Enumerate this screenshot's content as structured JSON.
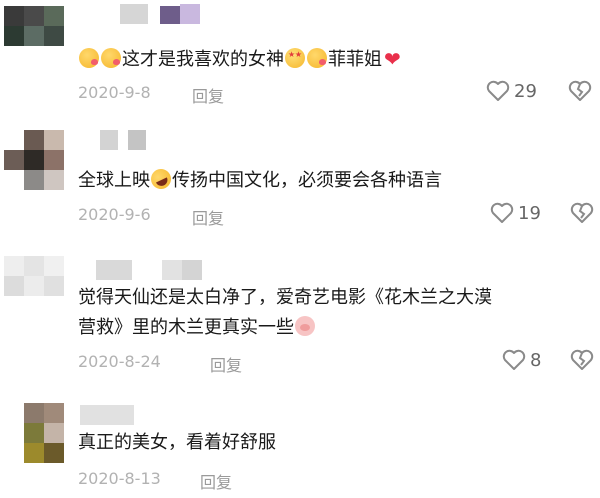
{
  "comments": [
    {
      "text_parts": [
        "这才是我喜欢的女神",
        "菲菲姐"
      ],
      "date": "2020-9-8",
      "reply_label": "回复",
      "likes": "29",
      "avatar_colors": [
        "#3a3a3a",
        "#4a4a4a",
        "#5a6a5a",
        "#2c3a32",
        "#5c6c64",
        "#3e4a44",
        "#ffffff",
        "#ffffff",
        "#ffffff"
      ],
      "nickname_colors": [
        "#d6d6d6",
        "#6e5d8a",
        "#c9b8df"
      ]
    },
    {
      "text_parts": [
        "全球上映",
        "传扬中国文化，必须要会各种语言"
      ],
      "date": "2020-9-6",
      "reply_label": "回复",
      "likes": "19",
      "avatar_colors": [
        "#ffffff",
        "#6a5a52",
        "#c9b9ad",
        "#6c5d56",
        "#2e2a26",
        "#8c7268",
        "#ffffff",
        "#8c8a88",
        "#cfc6c1"
      ],
      "nickname_colors": [
        "#d3d3d3",
        "#c4c4c4"
      ]
    },
    {
      "text_lines": [
        "觉得天仙还是太白净了，爱奇艺电影《花木兰之大漠",
        "营救》里的木兰更真实一些"
      ],
      "date": "2020-8-24",
      "reply_label": "回复",
      "likes": "8",
      "avatar_colors": [
        "#eeeeee",
        "#e4e4e4",
        "#f0f0f0",
        "#dcdcdc",
        "#ececec",
        "#e0e0e0",
        "#f4f4f4",
        "#f4f4f4",
        "#f4f4f4"
      ],
      "nickname_colors": [
        "#d9d9d9",
        "#e2e2e2",
        "#d4d4d4"
      ]
    },
    {
      "text_parts": [
        "真正的美女，看着好舒服"
      ],
      "date": "2020-8-13",
      "reply_label": "回复",
      "avatar_colors": [
        "#ffffff",
        "#8c7a6c",
        "#a08a7a",
        "#ffffff",
        "#7c7a3a",
        "#c4b4a8",
        "#ffffff",
        "#9c8a2c",
        "#6b5a2a"
      ],
      "nickname_colors": [
        "#e1e1e1"
      ]
    }
  ],
  "colors": {
    "like_outline": "#8a8a8a",
    "heart": "#e9304b"
  },
  "icons": [
    "kiss-emoji-icon",
    "star-eyes-emoji-icon",
    "rofl-emoji-icon",
    "pig-emoji-icon",
    "red-heart-icon",
    "like-icon",
    "dislike-icon"
  ]
}
